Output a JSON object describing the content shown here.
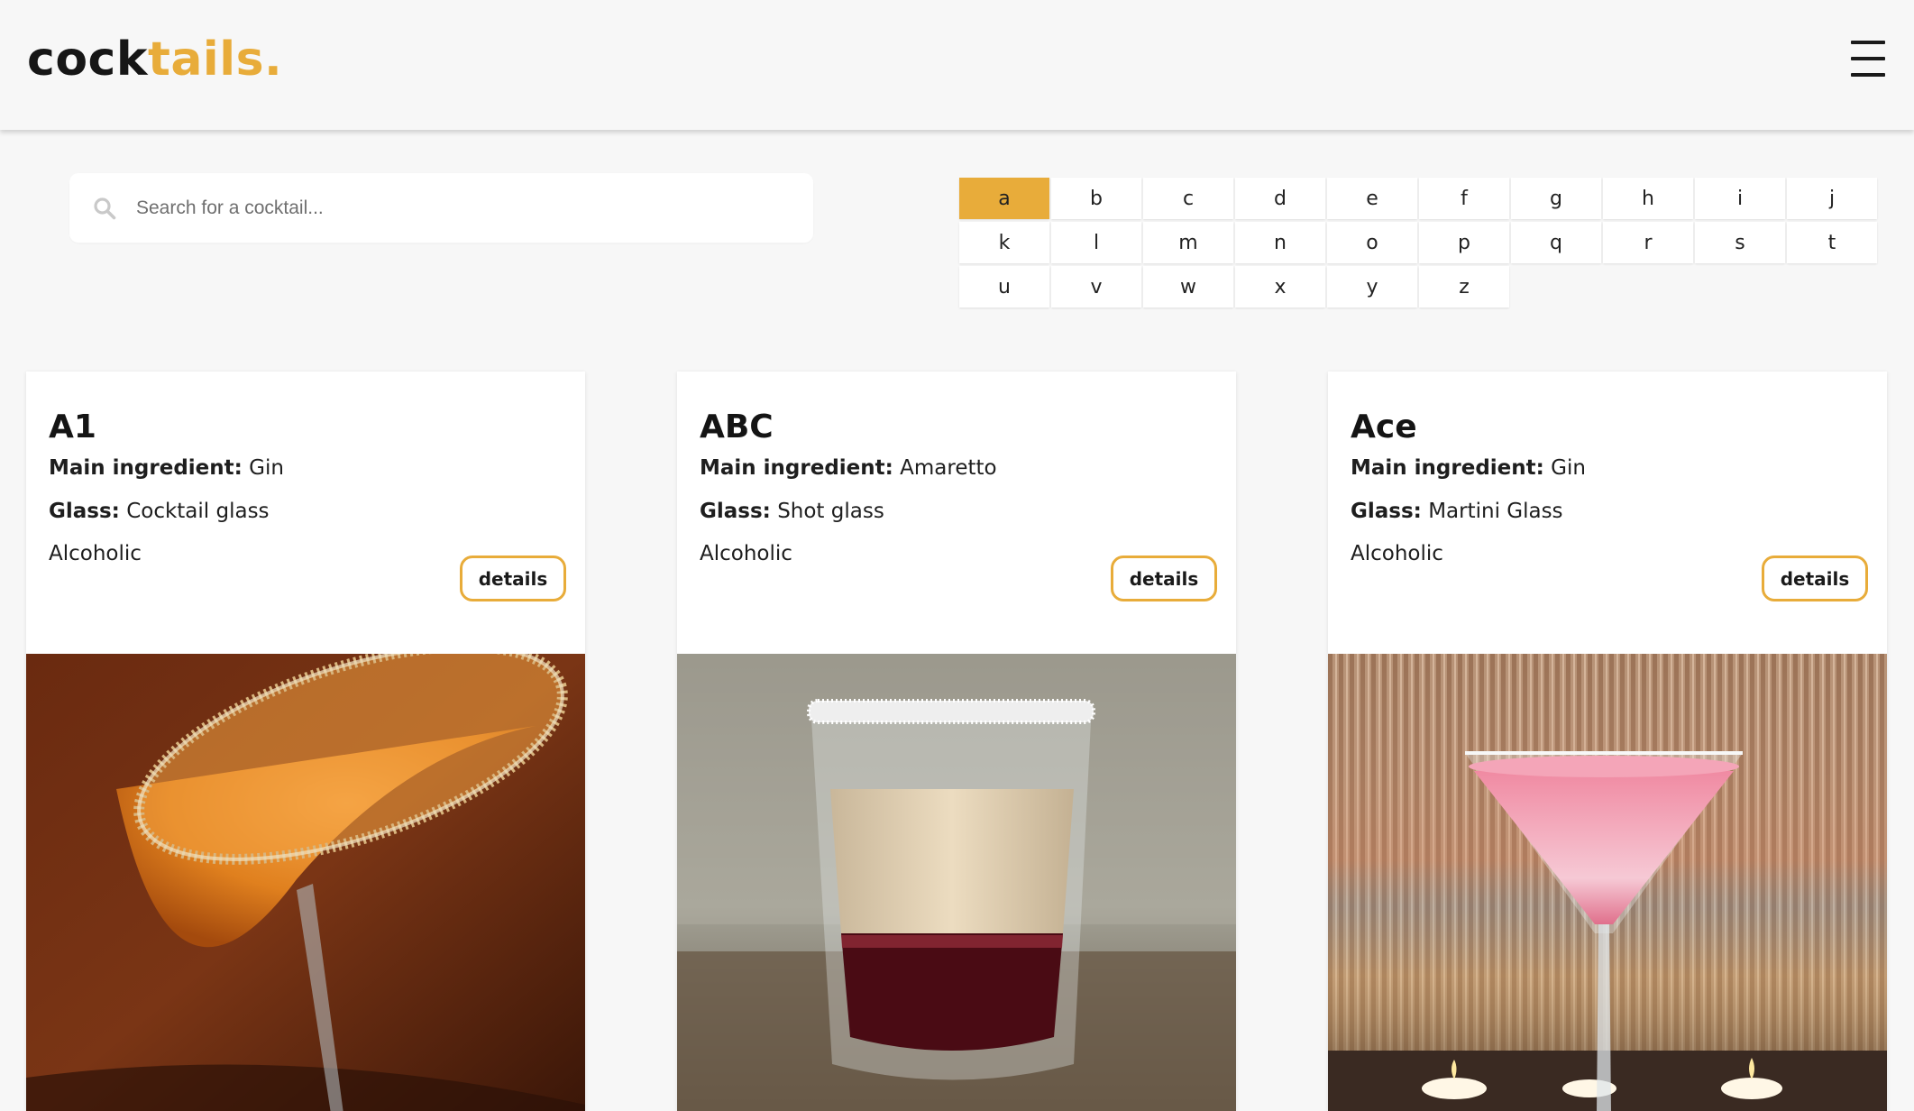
{
  "header": {
    "logo_part1": "cock",
    "logo_part2": "tails.",
    "menu_icon": "hamburger-menu-icon"
  },
  "search": {
    "placeholder": "Search for a cocktail...",
    "value": "",
    "icon": "search-icon"
  },
  "alphabet": {
    "selected": "a",
    "letters": [
      "a",
      "b",
      "c",
      "d",
      "e",
      "f",
      "g",
      "h",
      "i",
      "j",
      "k",
      "l",
      "m",
      "n",
      "o",
      "p",
      "q",
      "r",
      "s",
      "t",
      "u",
      "v",
      "w",
      "x",
      "y",
      "z"
    ]
  },
  "cards": [
    {
      "name": "A1",
      "main_ingredient_label": "Main ingredient:",
      "main_ingredient": "Gin",
      "glass_label": "Glass:",
      "glass": "Cocktail glass",
      "type": "Alcoholic",
      "button": "details"
    },
    {
      "name": "ABC",
      "main_ingredient_label": "Main ingredient:",
      "main_ingredient": "Amaretto",
      "glass_label": "Glass:",
      "glass": "Shot glass",
      "type": "Alcoholic",
      "button": "details"
    },
    {
      "name": "Ace",
      "main_ingredient_label": "Main ingredient:",
      "main_ingredient": "Gin",
      "glass_label": "Glass:",
      "glass": "Martini Glass",
      "type": "Alcoholic",
      "button": "details"
    }
  ],
  "colors": {
    "accent": "#e8ac3a",
    "background": "#f7f7f7",
    "card": "#ffffff",
    "text": "#1a1a1a"
  }
}
